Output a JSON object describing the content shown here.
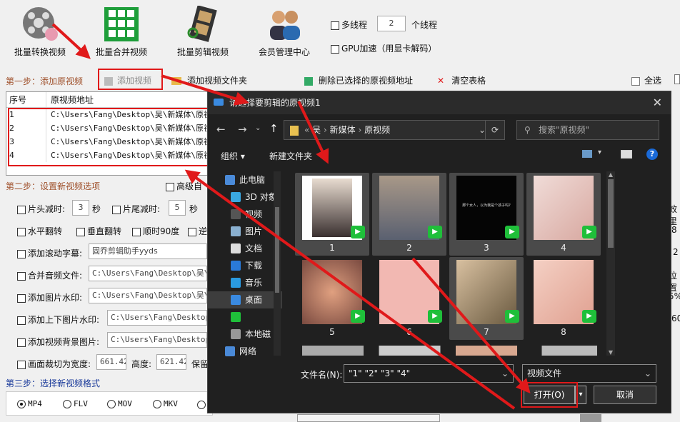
{
  "toolbar": {
    "buttons": [
      {
        "label": "批量转换视频",
        "icon": "film-reel-icon"
      },
      {
        "label": "批量合并视频",
        "icon": "merge-grid-icon"
      },
      {
        "label": "批量剪辑视频",
        "icon": "film-strip-icon"
      },
      {
        "label": "会员管理中心",
        "icon": "users-icon"
      }
    ],
    "multithread_label": "多线程",
    "thread_count": "2",
    "thread_unit": "个线程",
    "gpu_label": "GPU加速（用显卡解码）"
  },
  "step1": {
    "title": "第一步：添加原视频",
    "add_video": "添加视频",
    "add_folder": "添加视频文件夹",
    "delete_selected": "删除已选择的原视频地址",
    "clear_table": "清空表格",
    "select_all": "全选"
  },
  "table": {
    "headers": [
      "序号",
      "原视频地址"
    ],
    "rows": [
      {
        "idx": "1",
        "path": "C:\\Users\\Fang\\Desktop\\吴\\新媒体\\原视"
      },
      {
        "idx": "2",
        "path": "C:\\Users\\Fang\\Desktop\\吴\\新媒体\\原视"
      },
      {
        "idx": "3",
        "path": "C:\\Users\\Fang\\Desktop\\吴\\新媒体\\原视"
      },
      {
        "idx": "4",
        "path": "C:\\Users\\Fang\\Desktop\\吴\\新媒体\\原视"
      }
    ]
  },
  "step2": {
    "title": "第二步：设置新视频选项",
    "advanced": "高级自",
    "head_cut": "片头减时:",
    "head_val": "3",
    "sec1": "秒",
    "tail_cut": "片尾减时:",
    "tail_val": "5",
    "sec2": "秒",
    "hflip": "水平翻转",
    "vflip": "垂直翻转",
    "rot90": "顺时90度",
    "rev": "逆",
    "subtitle": "添加滚动字幕:",
    "subtitle_val": "固乔剪辑助手yyds",
    "merge_audio": "合并音频文件:",
    "merge_audio_val": "C:\\Users\\Fang\\Desktop\\吴\\新",
    "img_wm": "添加图片水印:",
    "img_wm_val": "C:\\Users\\Fang\\Desktop\\吴\\各",
    "tb_wm": "添加上下图片水印:",
    "tb_wm_val": "C:\\Users\\Fang\\Desktop\\吴",
    "bg_img": "添加视频背景图片:",
    "bg_img_val": "C:\\Users\\Fang\\Desktop\\吴",
    "crop": "画面裁切为宽度:",
    "crop_w": "661.42",
    "height": "高度:",
    "crop_h": "621.42",
    "keep": "保留"
  },
  "step3": {
    "title": "第三步：选择新视频格式",
    "formats": [
      "MP4",
      "FLV",
      "MOV",
      "MKV"
    ]
  },
  "right_edge": {
    "t1": "效里",
    "t2": "8",
    "t3": "2",
    "t4": "位置",
    "t5": "5%",
    "t6": "60"
  },
  "dialog": {
    "title": "请选择要剪辑的原视频1",
    "breadcrumb": [
      "吴",
      "新媒体",
      "原视频"
    ],
    "search_placeholder": "搜索\"原视频\"",
    "organize": "组织",
    "new_folder": "新建文件夹",
    "nav": [
      "此电脑",
      "3D 对象",
      "视频",
      "图片",
      "文档",
      "下载",
      "音乐",
      "桌面",
      "",
      "本地磁",
      "网络"
    ],
    "thumbs": [
      {
        "label": "1",
        "color": "#d8c8b8",
        "selected": true
      },
      {
        "label": "2",
        "color": "#b8a898",
        "selected": true
      },
      {
        "label": "3",
        "color": "#050505",
        "selected": true,
        "caption": "那个女人，以为我是个孩子吗?"
      },
      {
        "label": "4",
        "color": "#e8c8c0",
        "selected": true
      },
      {
        "label": "5",
        "color": "#c89080",
        "selected": false
      },
      {
        "label": "6",
        "color": "#f0b8b0",
        "selected": false
      },
      {
        "label": "7",
        "color": "#b0a080",
        "selected": true
      },
      {
        "label": "8",
        "color": "#f0c8b8",
        "selected": false
      }
    ],
    "filename_label": "文件名(N):",
    "filename_value": "\"1\" \"2\" \"3\" \"4\"",
    "filetype": "视频文件",
    "open": "打开(O)",
    "cancel": "取消"
  },
  "colors": {
    "accent_red": "#e0191a",
    "step_color": "#a0522d",
    "play_green": "#1fbf3a"
  }
}
